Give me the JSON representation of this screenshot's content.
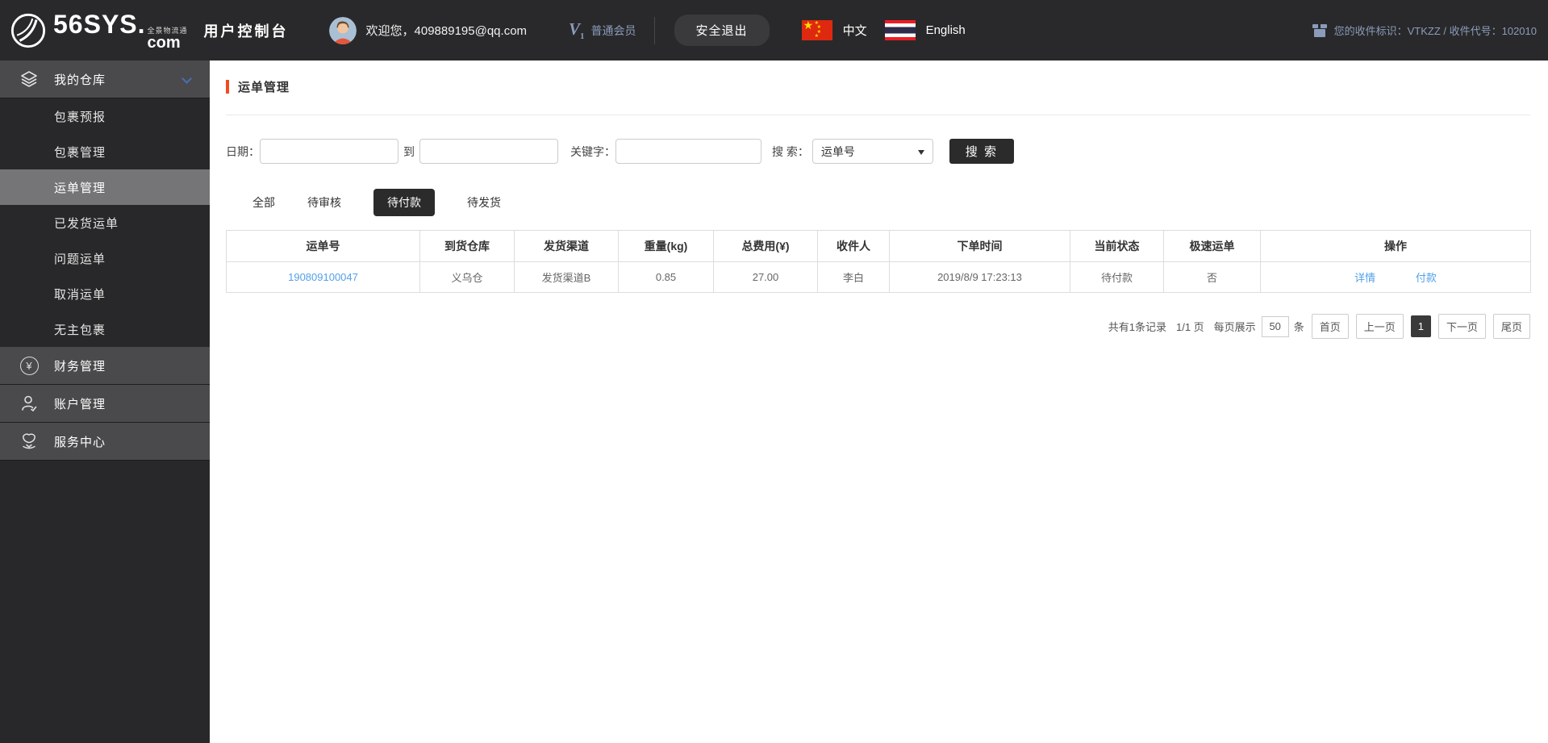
{
  "colors": {
    "header_bg": "#29292b",
    "sidebar_group_bg": "#4a4a4c",
    "active_item_bg": "#757578",
    "accent_red": "#f04b22",
    "link_blue": "#53a0e8",
    "dark_button": "#2b2b2b",
    "muted_blue_text": "#8b9cba",
    "chevron_blue": "#4c6db3"
  },
  "header": {
    "logo_main": "56SYS.",
    "logo_tagline": "全景物流通",
    "logo_com": "com",
    "console_title": "用户控制台",
    "welcome": "欢迎您，409889195@qq.com",
    "member_badge_v": "V",
    "member_badge_level": "1",
    "member_level": "普通会员",
    "logout_label": "安全退出",
    "lang_zh": "中文",
    "lang_en": "English",
    "receiver_info": "您的收件标识：VTKZZ / 收件代号：102010",
    "flag_star": "★"
  },
  "sidebar": {
    "groups": [
      {
        "label": "我的仓库",
        "glyph": ""
      },
      {
        "label": "财务管理",
        "glyph": "¥"
      },
      {
        "label": "账户管理",
        "glyph": ""
      },
      {
        "label": "服务中心",
        "glyph": ""
      }
    ],
    "warehouse_items": [
      {
        "label": "包裹预报",
        "active": false
      },
      {
        "label": "包裹管理",
        "active": false
      },
      {
        "label": "运单管理",
        "active": true
      },
      {
        "label": "已发货运单",
        "active": false
      },
      {
        "label": "问题运单",
        "active": false
      },
      {
        "label": "取消运单",
        "active": false
      },
      {
        "label": "无主包裹",
        "active": false
      }
    ]
  },
  "main": {
    "page_title": "运单管理",
    "search": {
      "date_label": "日期：",
      "to_label": "到",
      "keyword_label": "关键字：",
      "search_label": "搜 索：",
      "search_type_selected": "运单号",
      "search_button": "搜 索"
    },
    "tabs": [
      {
        "label": "全部",
        "active": false
      },
      {
        "label": "待审核",
        "active": false
      },
      {
        "label": "待付款",
        "active": true
      },
      {
        "label": "待发货",
        "active": false
      }
    ],
    "table": {
      "headers": [
        "运单号",
        "到货仓库",
        "发货渠道",
        "重量(kg)",
        "总费用(¥)",
        "收件人",
        "下单时间",
        "当前状态",
        "极速运单",
        "操作"
      ],
      "rows": [
        {
          "waybill_no": "190809100047",
          "warehouse": "义乌仓",
          "channel": "发货渠道B",
          "weight": "0.85",
          "total_fee": "27.00",
          "receiver": "李白",
          "order_time": "2019/8/9 17:23:13",
          "status": "待付款",
          "express": "否",
          "actions": [
            "详情",
            "付款"
          ]
        }
      ]
    },
    "pagination": {
      "total_text": "共有1条记录",
      "page_text": "1/1 页",
      "per_page_label": "每页展示",
      "per_page_value": "50",
      "per_page_unit": "条",
      "first": "首页",
      "prev": "上一页",
      "current": "1",
      "next": "下一页",
      "last": "尾页"
    }
  }
}
